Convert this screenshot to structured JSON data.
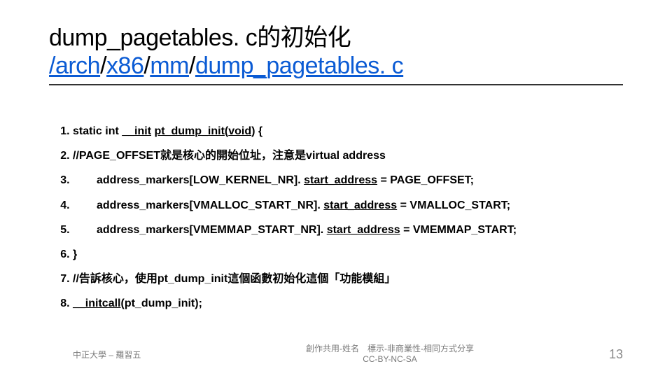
{
  "title": {
    "line1": "dump_pagetables. c的初始化",
    "path": {
      "seg1": "/arch",
      "seg2": "x86",
      "seg3": "mm",
      "seg4": "dump_pagetables. c"
    }
  },
  "code": {
    "l1_pre": "static int ",
    "l1_u1": "__init",
    "l1_mid": " ",
    "l1_u2": "pt_dump_init",
    "l1_paren_open": "(",
    "l1_u3": "void",
    "l1_post": ") {",
    "l2": "//PAGE_OFFSET就是核心的開始位址，注意是virtual address",
    "l3_pre": "address_markers[LOW_KERNEL_NR]. ",
    "l3_u": "start_address",
    "l3_post": " = PAGE_OFFSET;",
    "l4_pre": "address_markers[VMALLOC_START_NR]. ",
    "l4_u": "start_address",
    "l4_post": " = VMALLOC_START;",
    "l5_pre": "address_markers[VMEMMAP_START_NR]. ",
    "l5_u": "start_address",
    "l5_post": " = VMEMMAP_START;",
    "l6": "}",
    "l7": "//告訴核心，使用pt_dump_init這個函數初始化這個「功能模組」",
    "l8_u": "__initcall",
    "l8_post": "(pt_dump_init);"
  },
  "footer": {
    "left": "中正大學 – 羅習五",
    "center_line1": "創作共用-姓名　標示-非商業性-相同方式分享",
    "center_line2": "CC-BY-NC-SA",
    "page": "13"
  }
}
